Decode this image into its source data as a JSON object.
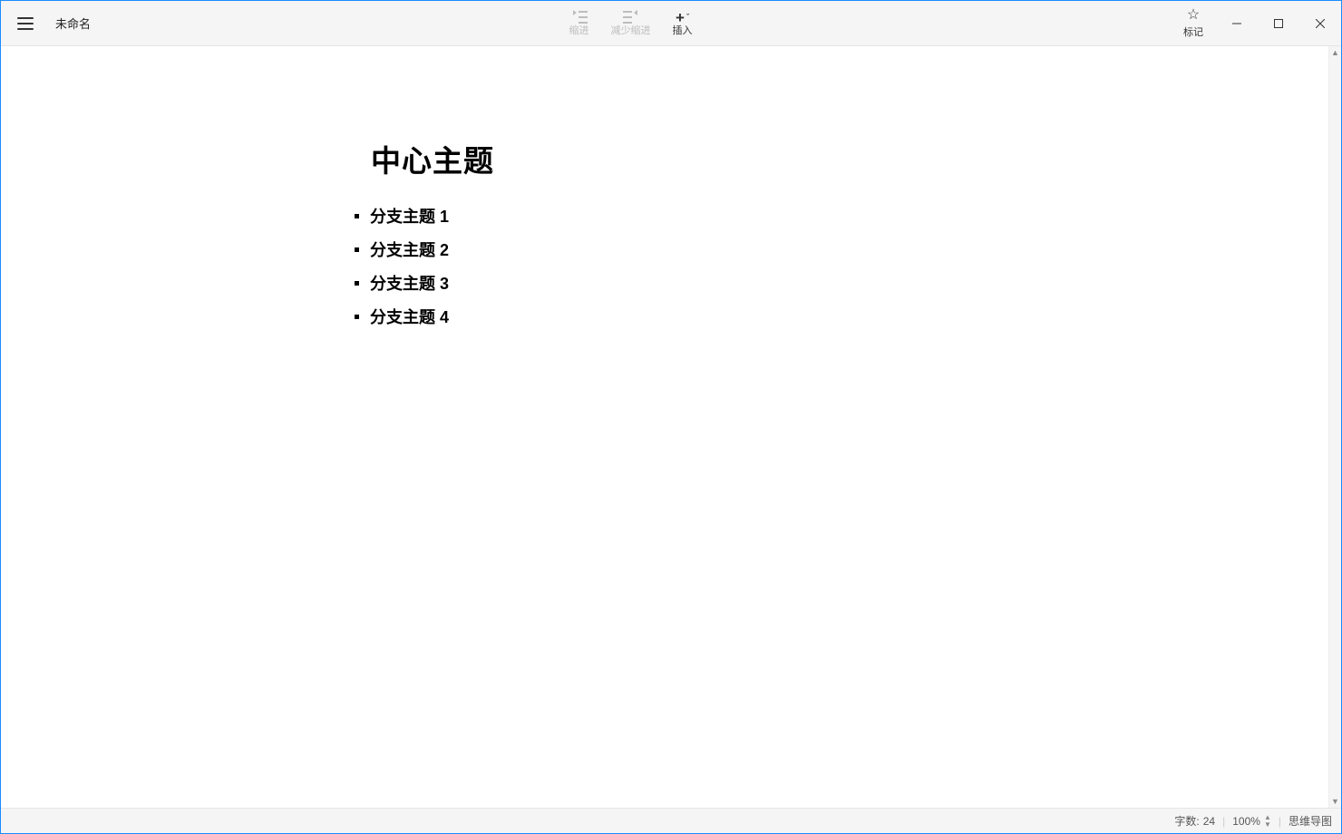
{
  "window": {
    "doc_title": "未命名"
  },
  "toolbar": {
    "indent": {
      "label": "缩进"
    },
    "outdent": {
      "label": "减少缩进"
    },
    "insert": {
      "label": "插入"
    },
    "mark": {
      "label": "标记"
    }
  },
  "content": {
    "central_topic": "中心主题",
    "branches": [
      "分支主题 1",
      "分支主题 2",
      "分支主题 3",
      "分支主题 4"
    ]
  },
  "statusbar": {
    "word_count_label": "字数:",
    "word_count_value": "24",
    "zoom": "100%",
    "mode_label": "思维导图"
  }
}
